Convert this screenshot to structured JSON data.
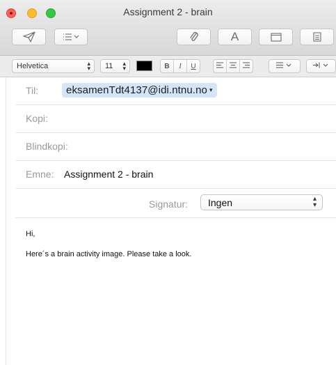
{
  "window": {
    "title": "Assignment 2 - brain"
  },
  "toolbar": {
    "send_icon": "paper-plane-icon",
    "header_fields_icon": "list-icon",
    "attach_icon": "paperclip-icon",
    "fonts_label": "A",
    "photo_browser_icon": "window-icon",
    "format_icon": "calculator-icon"
  },
  "format": {
    "font_family": "Helvetica",
    "font_size": "11",
    "text_color": "#000000",
    "bold": "B",
    "italic": "I",
    "underline": "U",
    "list_icon": "list-icon",
    "indent_icon": "indent-icon"
  },
  "headers": {
    "to_label": "Til:",
    "to_value": "eksamenTdt4137@idi.ntnu.no",
    "cc_label": "Kopi:",
    "bcc_label": "Blindkopi:",
    "subject_label": "Emne:",
    "subject_value": "Assignment 2 - brain",
    "signature_label": "Signatur:",
    "signature_value": "Ingen"
  },
  "message": {
    "greeting": "Hi,",
    "text": "Here´s a brain activity image. Please take a look."
  }
}
